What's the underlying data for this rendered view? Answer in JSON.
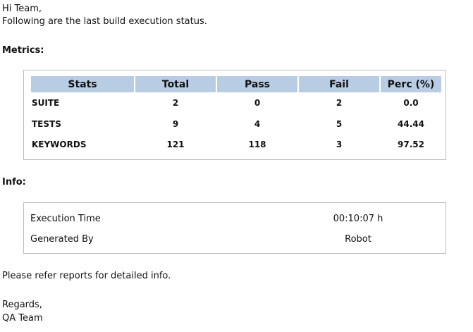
{
  "greeting": "Hi Team,",
  "intro": "Following are the last build execution status.",
  "metrics_heading": "Metrics:",
  "metrics": {
    "headers": [
      "Stats",
      "Total",
      "Pass",
      "Fail",
      "Perc (%)"
    ],
    "rows": [
      [
        "SUITE",
        "2",
        "0",
        "2",
        "0.0"
      ],
      [
        "TESTS",
        "9",
        "4",
        "5",
        "44.44"
      ],
      [
        "KEYWORDS",
        "121",
        "118",
        "3",
        "97.52"
      ]
    ],
    "header_color": "#b8cce4"
  },
  "info_heading": "Info:",
  "info": {
    "rows": [
      [
        "Execution Time",
        "00:10:07 h"
      ],
      [
        "Generated By",
        "Robot"
      ]
    ]
  },
  "note": "Please refer reports for detailed info.",
  "closing": "Regards,",
  "signature": "QA Team"
}
